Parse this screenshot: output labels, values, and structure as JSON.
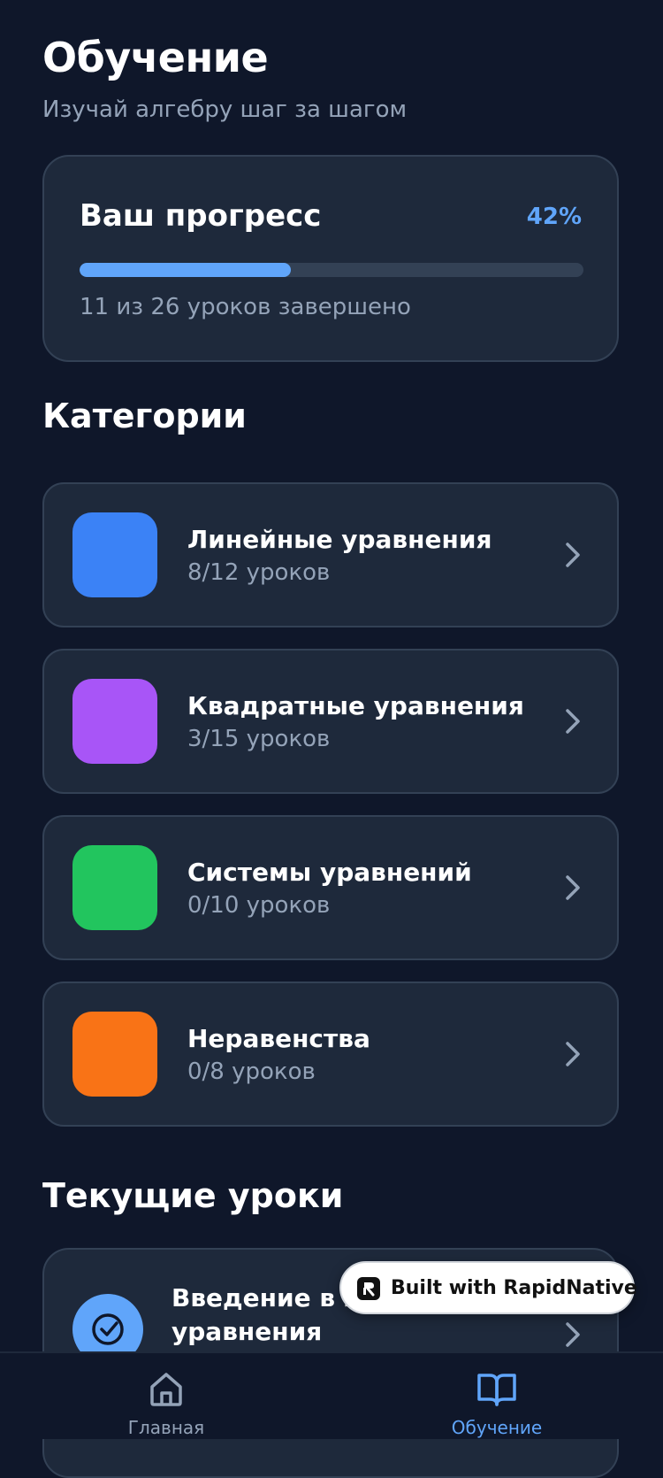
{
  "header": {
    "title": "Обучение",
    "subtitle": "Изучай алгебру шаг за шагом"
  },
  "progress": {
    "title": "Ваш прогресс",
    "percent_label": "42%",
    "percent": 42,
    "caption": "11 из 26 уроков завершено"
  },
  "categories": {
    "title": "Категории",
    "items": [
      {
        "name": "Линейные уравнения",
        "count": "8/12 уроков",
        "color": "#3b82f6"
      },
      {
        "name": "Квадратные уравнения",
        "count": "3/15 уроков",
        "color": "#a855f7"
      },
      {
        "name": "Системы уравнений",
        "count": "0/10 уроков",
        "color": "#22c55e"
      },
      {
        "name": "Неравенства",
        "count": "0/8 уроков",
        "color": "#f97316"
      }
    ]
  },
  "current_lessons": {
    "title": "Текущие уроки",
    "items": [
      {
        "title": "Введение в линейные уравнения",
        "icon": "check-circle-icon"
      }
    ]
  },
  "badge": {
    "text": "Built with RapidNative"
  },
  "tabbar": {
    "items": [
      {
        "label": "Главная",
        "icon": "home-icon",
        "active": false
      },
      {
        "label": "Обучение",
        "icon": "book-open-icon",
        "active": true
      }
    ]
  },
  "colors": {
    "background": "#0f172a",
    "card": "#1e293b",
    "accent": "#60a5fa",
    "muted": "#94a3b8",
    "tab_inactive": "#94a3b8"
  }
}
